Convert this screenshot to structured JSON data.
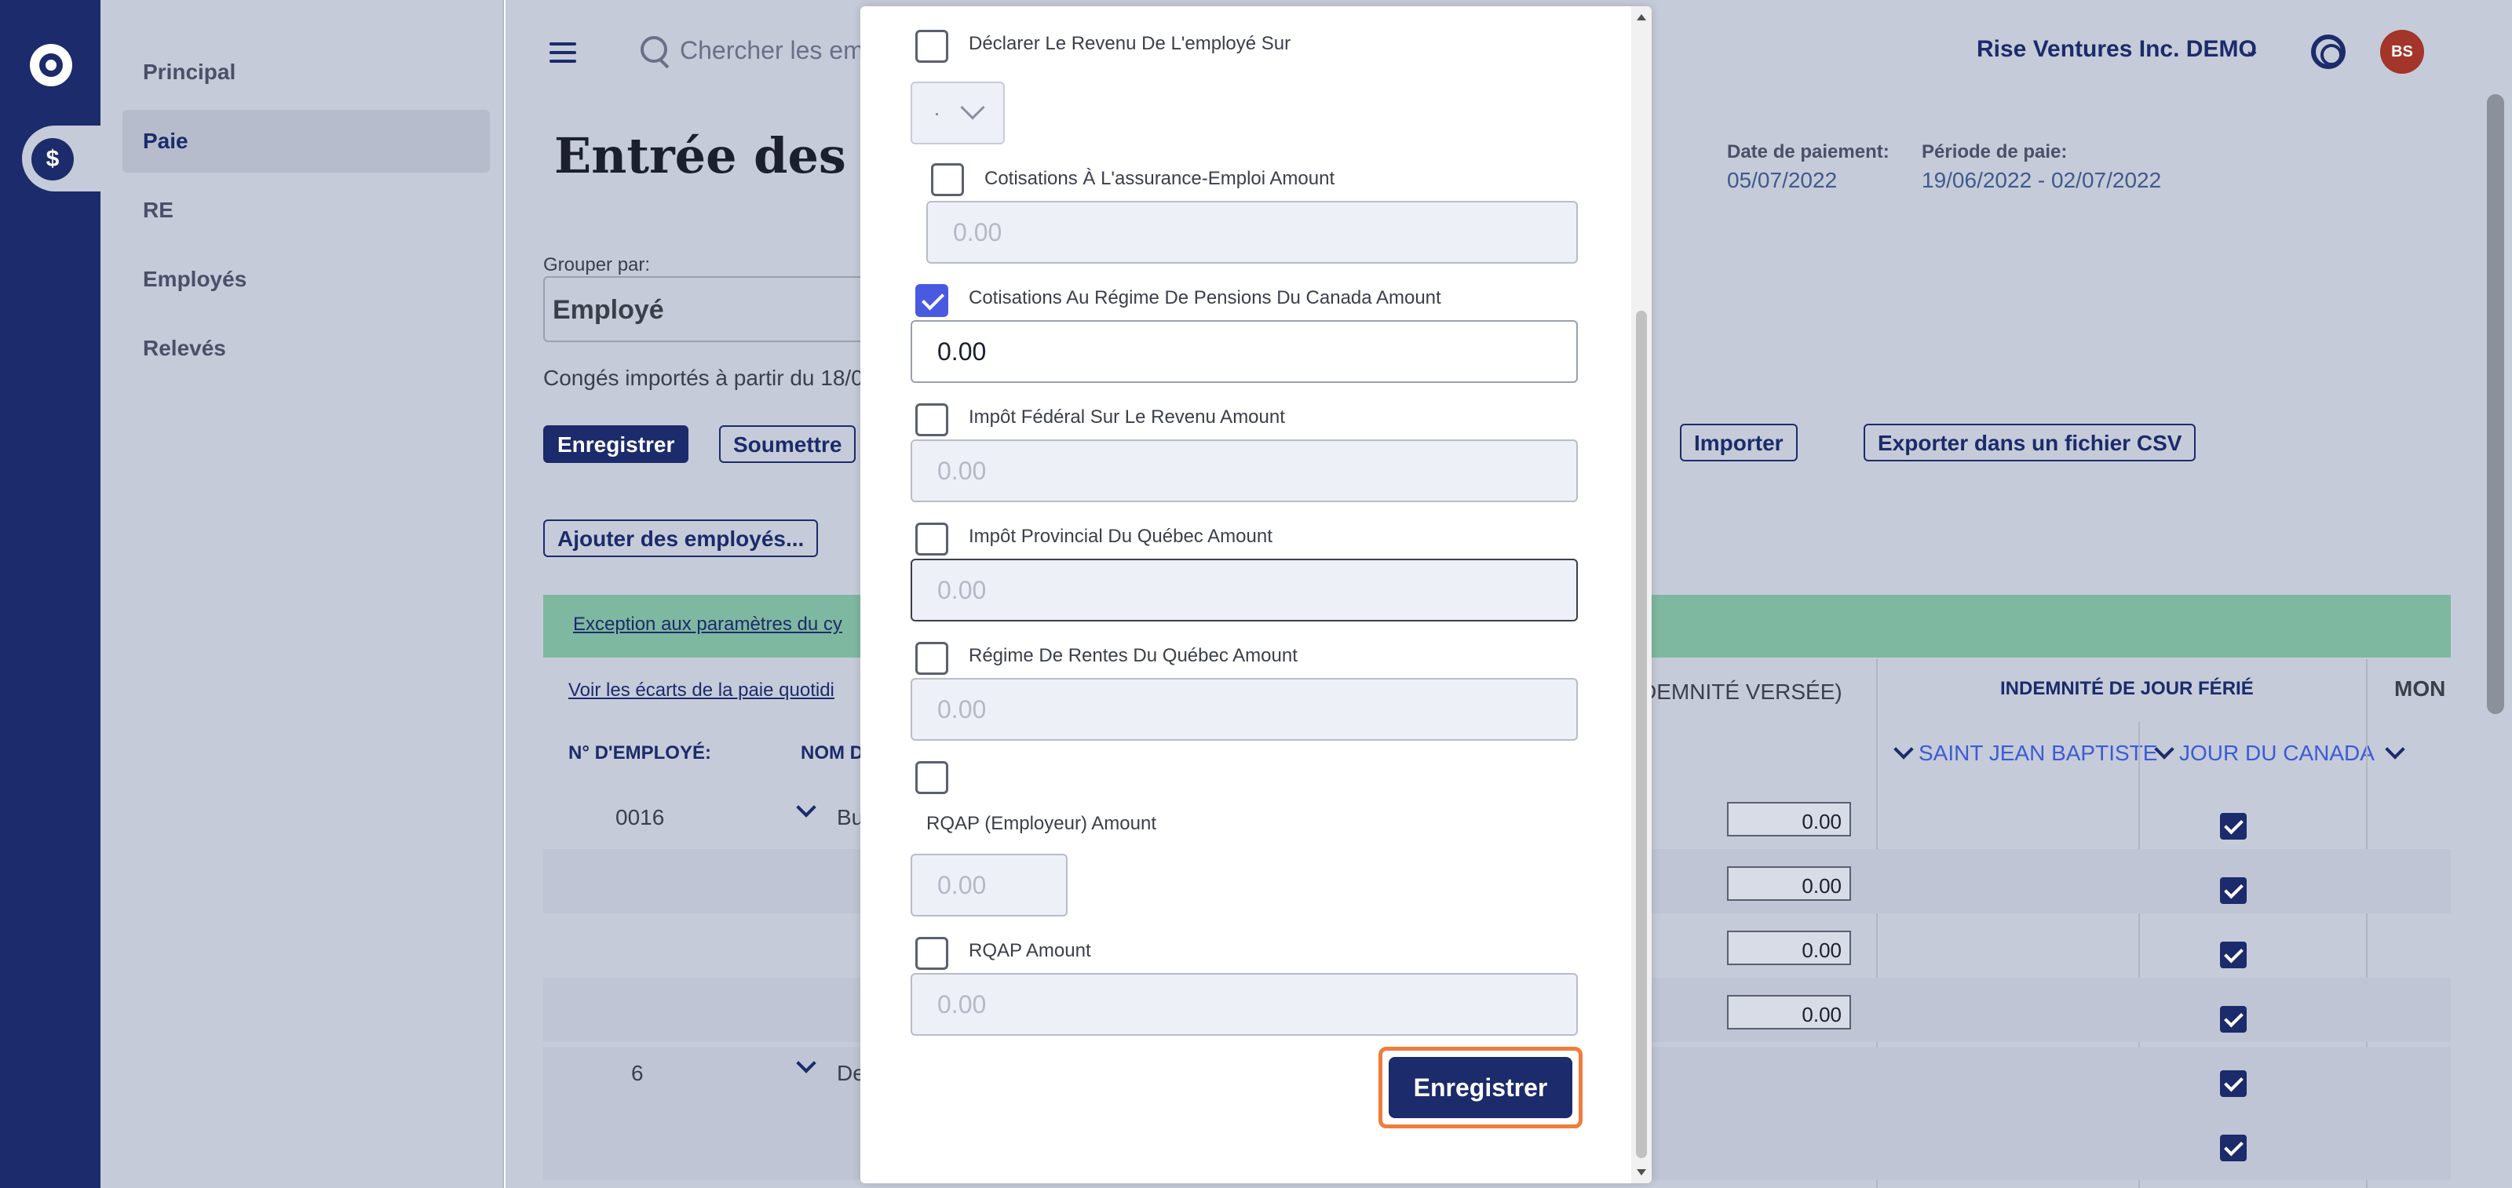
{
  "colors": {
    "rail": "#1b2b6b",
    "overlay_bg": "#c6cbd9",
    "primary": "#1b2b6b",
    "checkbox_checked": "#4a5ae0",
    "highlight": "#f07c3c",
    "avatar": "#a3352a",
    "banner": "#7fb8a0"
  },
  "rail": {
    "logo_icon": "logo-icon",
    "payroll_icon": "dollar-icon"
  },
  "sidemenu": {
    "items": [
      {
        "label": "Principal"
      },
      {
        "label": "Paie"
      },
      {
        "label": "RE"
      },
      {
        "label": "Employés"
      },
      {
        "label": "Relevés"
      }
    ],
    "active_index": 1
  },
  "header": {
    "search_placeholder": "Chercher les em",
    "company": "Rise Ventures Inc. DEMO",
    "avatar_initials": "BS"
  },
  "page": {
    "title": "Entrée des do",
    "payment_date_label": "Date de paiement:",
    "payment_date": "05/07/2022",
    "pay_period_label": "Période de paie:",
    "pay_period": "19/06/2022 - 02/07/2022",
    "group_by_label": "Grouper par:",
    "group_by_value": "Employé",
    "leave_text": "Congés importés à partir du 18/0",
    "buttons": {
      "save": "Enregistrer",
      "submit": "Soumettre",
      "import": "Importer",
      "export_csv": "Exporter dans un fichier CSV",
      "add_employees": "Ajouter des employés..."
    },
    "links": {
      "exception": "Exception aux paramètres du cy",
      "daily_gaps": "Voir les écarts de la paie quotidi"
    },
    "table": {
      "headers": {
        "employee_no": "N° D'EMPLOYÉ:",
        "name": "NOM D",
        "indemnity_paid": "DEMNITÉ VERSÉE)",
        "holiday_indemnity": "INDEMNITÉ DE JOUR FÉRIÉ",
        "mon": "MON",
        "saint_jean": "SAINT JEAN BAPTISTE",
        "canada_day": "JOUR DU CANADA"
      },
      "rows": [
        {
          "employee_no": "0016",
          "name": "Bu",
          "amounts": [
            "0.00",
            "0.00",
            "0.00",
            "0.00"
          ]
        },
        {
          "employee_no": "6",
          "name": "De",
          "amounts": []
        }
      ]
    }
  },
  "modal": {
    "fields": [
      {
        "label": "Déclarer Le Revenu De L'employé Sur",
        "checked": false,
        "kind": "select"
      },
      {
        "label": "Cotisations À L'assurance-Emploi Amount",
        "checked": false,
        "value": "0.00"
      },
      {
        "label": "Cotisations Au Régime De Pensions Du Canada Amount",
        "checked": true,
        "value": "0.00"
      },
      {
        "label": "Impôt Fédéral Sur Le Revenu Amount",
        "checked": false,
        "value": "0.00"
      },
      {
        "label": "Impôt Provincial Du Québec Amount",
        "checked": false,
        "value": "0.00"
      },
      {
        "label": "Régime De Rentes Du Québec Amount",
        "checked": false,
        "value": "0.00"
      },
      {
        "label": "RQAP (Employeur) Amount",
        "checked": false,
        "value": "0.00"
      },
      {
        "label": "RQAP Amount",
        "checked": false,
        "value": "0.00"
      }
    ],
    "save_label": "Enregistrer"
  }
}
